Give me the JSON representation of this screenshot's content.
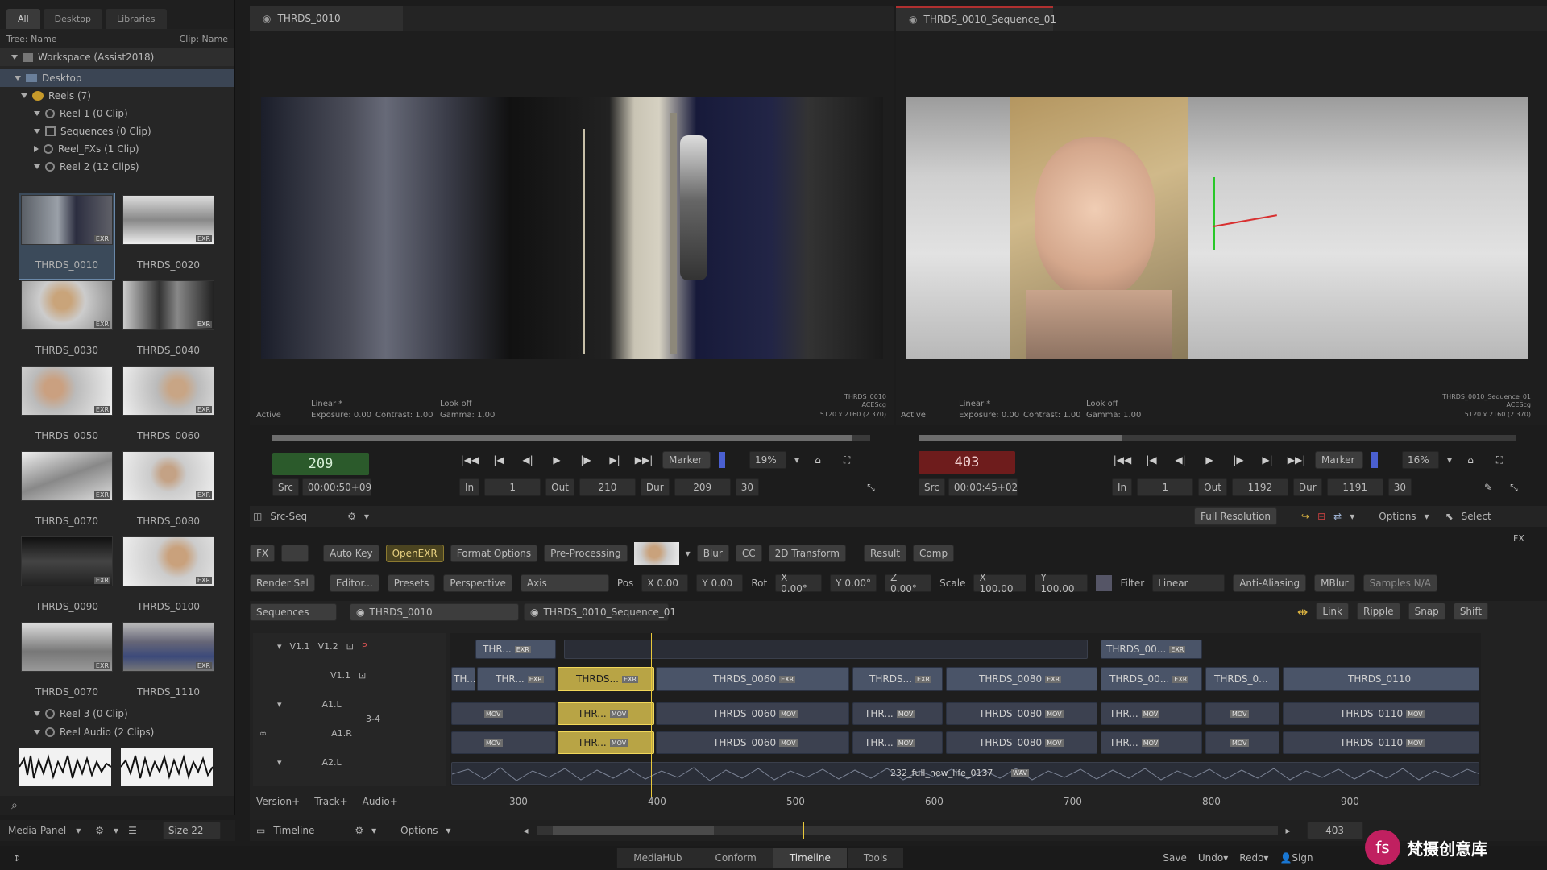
{
  "left": {
    "tabs": [
      "All",
      "Desktop",
      "Libraries"
    ],
    "tree_header": "Tree: Name",
    "clip_header": "Clip: Name",
    "workspace": "Workspace (Assist2018)",
    "desktop": "Desktop",
    "reels": "Reels (7)",
    "reel1": "Reel 1 (0 Clip)",
    "sequences": "Sequences (0 Clip)",
    "reel_fxs": "Reel_FXs (1 Clip)",
    "reel2": "Reel 2 (12 Clips)",
    "clips": [
      "THRDS_0010",
      "THRDS_0020",
      "THRDS_0030",
      "THRDS_0040",
      "THRDS_0050",
      "THRDS_0060",
      "THRDS_0070",
      "THRDS_0080",
      "THRDS_0090",
      "THRDS_0100",
      "THRDS_0070",
      "THRDS_1110"
    ],
    "reel3": "Reel 3 (0 Clip)",
    "reel_audio": "Reel Audio (2 Clips)",
    "media_panel": "Media Panel",
    "size": "Size 22"
  },
  "viewer_left": {
    "tab": "THRDS_0010",
    "status_active": "Active",
    "status_linear": "Linear *",
    "exposure": "Exposure: 0.00",
    "contrast": "Contrast: 1.00",
    "lookoff": "Look off",
    "gamma": "Gamma: 1.00",
    "clipinfo1": "THRDS_0010",
    "clipinfo2": "ACEScg",
    "clipinfo3": "5120 x 2160 (2.370)",
    "frame": "209",
    "src_label": "Src",
    "src_tc": "00:00:50+09",
    "in_label": "In",
    "in_val": "1",
    "out_label": "Out",
    "out_val": "210",
    "dur_label": "Dur",
    "dur_val": "209",
    "fps": "30",
    "marker": "Marker",
    "zoom": "19%"
  },
  "viewer_right": {
    "tab": "THRDS_0010_Sequence_01",
    "status_active": "Active",
    "status_linear": "Linear *",
    "exposure": "Exposure: 0.00",
    "contrast": "Contrast: 1.00",
    "lookoff": "Look off",
    "gamma": "Gamma: 1.00",
    "clipinfo1": "THRDS_0010_Sequence_01",
    "clipinfo2": "ACEScg",
    "clipinfo3": "5120 x 2160 (2.370)",
    "frame": "403",
    "src_label": "Src",
    "src_tc": "00:00:45+02",
    "in_label": "In",
    "in_val": "1",
    "out_label": "Out",
    "out_val": "1192",
    "dur_label": "Dur",
    "dur_val": "1191",
    "fps": "30",
    "marker": "Marker",
    "zoom": "16%"
  },
  "toolbar": {
    "src_seq": "Src-Seq",
    "full_res": "Full Resolution",
    "options": "Options",
    "select": "Select",
    "fx_label": "FX"
  },
  "fx": {
    "fx": "FX",
    "auto_key": "Auto Key",
    "open_exr": "OpenEXR",
    "format_options": "Format Options",
    "pre_processing": "Pre-Processing",
    "blur": "Blur",
    "cc": "CC",
    "transform": "2D Transform",
    "result": "Result",
    "comp": "Comp",
    "render_sel": "Render Sel",
    "editor": "Editor...",
    "presets": "Presets",
    "perspective": "Perspective",
    "axis": "Axis",
    "pos": "Pos",
    "pos_x": "X 0.00",
    "pos_y": "Y 0.00",
    "rot": "Rot",
    "rot_x": "X 0.00°",
    "rot_y": "Y 0.00°",
    "rot_z": "Z 0.00°",
    "scale": "Scale",
    "scale_x": "X 100.00",
    "scale_y": "Y 100.00",
    "filter": "Filter",
    "filter_val": "Linear",
    "anti_aliasing": "Anti-Aliasing",
    "mblur": "MBlur",
    "samples": "Samples N/A"
  },
  "timeline": {
    "sequences": "Sequences",
    "tab1": "THRDS_0010",
    "tab2": "THRDS_0010_Sequence_01",
    "link": "Link",
    "ripple": "Ripple",
    "snap": "Snap",
    "shift": "Shift",
    "v12": "V1.2",
    "v11a": "V1.1",
    "v11": "V1.1",
    "p": "P",
    "a1l": "A1.L",
    "a1r": "A1.R",
    "a34": "3-4",
    "a2l": "A2.L",
    "clip_thr": "THR...",
    "clip_th": "TH...",
    "clip_thrds": "THRDS...",
    "clip_0060": "THRDS_0060",
    "clip_0080": "THRDS_0080",
    "clip_thrds00": "THRDS_00...",
    "clip_thrds0": "THRDS_0...",
    "clip_0110": "THRDS_0110",
    "audio_file": "232_full_new_life_0137",
    "wav": "WAV",
    "mov": "MOV",
    "exr": "EXR",
    "ruler": [
      "300",
      "400",
      "500",
      "600",
      "700",
      "800",
      "900"
    ],
    "version": "Version+",
    "track": "Track+",
    "audio": "Audio+",
    "timeline_label": "Timeline",
    "options": "Options",
    "pos_frame": "403"
  },
  "bottom": {
    "tabs": [
      "MediaHub",
      "Conform",
      "Timeline",
      "Tools"
    ],
    "save": "Save",
    "undo": "Undo",
    "redo": "Redo",
    "sign": "Sign",
    "watermark": "梵摄创意库",
    "watermark_logo": "fs"
  }
}
